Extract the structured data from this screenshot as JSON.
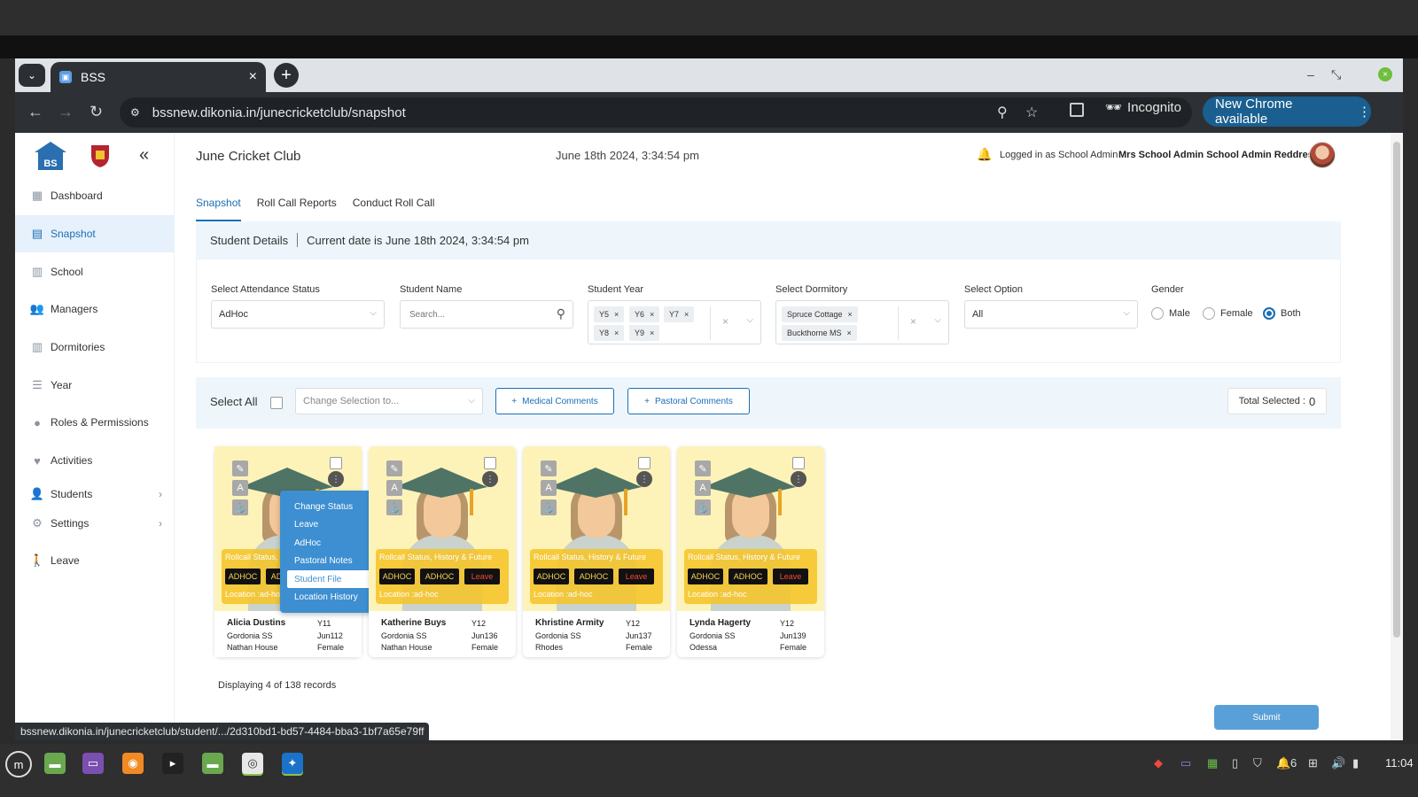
{
  "browser": {
    "tab_title": "BSS",
    "url": "bssnew.dikonia.in/junecricketclub/snapshot",
    "incognito_label": "Incognito",
    "update_label": "New Chrome available",
    "status_url": "bssnew.dikonia.in/junecricketclub/student/.../2d310bd1-bd57-4484-bba3-1bf7a65e79ff"
  },
  "sidebar": {
    "items": [
      {
        "label": "Dashboard",
        "icon": "dashboard-icon"
      },
      {
        "label": "Snapshot",
        "icon": "snapshot-icon",
        "active": true
      },
      {
        "label": "School",
        "icon": "school-icon"
      },
      {
        "label": "Managers",
        "icon": "managers-icon"
      },
      {
        "label": "Dormitories",
        "icon": "dormitories-icon"
      },
      {
        "label": "Year",
        "icon": "year-icon"
      },
      {
        "label": "Roles & Permissions",
        "icon": "roles-icon"
      },
      {
        "label": "Activities",
        "icon": "activities-icon"
      },
      {
        "label": "Students",
        "icon": "students-icon"
      },
      {
        "label": "Settings",
        "icon": "gear-icon"
      },
      {
        "label": "Leave",
        "icon": "leave-icon"
      }
    ]
  },
  "header": {
    "title": "June Cricket Club",
    "datetime": "June 18th 2024, 3:34:54 pm",
    "logged_in": "Logged in as School Admin",
    "user_name": "Mrs School Admin School Admin Reddress"
  },
  "tabs": [
    "Snapshot",
    "Roll Call Reports",
    "Conduct Roll Call"
  ],
  "student_details": {
    "title": "Student Details",
    "current_date": "Current date is June 18th 2024, 3:34:54 pm"
  },
  "filters": {
    "attendance_label": "Select Attendance Status",
    "attendance_value": "AdHoc",
    "name_label": "Student Name",
    "name_placeholder": "Search...",
    "year_label": "Student Year",
    "years": [
      "Y5",
      "Y6",
      "Y7",
      "Y8",
      "Y9"
    ],
    "dorm_label": "Select Dormitory",
    "dorms": [
      "Spruce Cottage",
      "Buckthorne MS"
    ],
    "option_label": "Select Option",
    "option_value": "All",
    "gender_label": "Gender",
    "genders": [
      "Male",
      "Female",
      "Both"
    ],
    "gender_selected": "Both"
  },
  "selection": {
    "select_all": "Select All",
    "change_placeholder": "Change Selection to...",
    "medical": "Medical Comments",
    "pastoral": "Pastoral Comments",
    "total_label": "Total Selected :",
    "total_value": "0"
  },
  "students": [
    {
      "name": "Alicia Dustins",
      "year": "Y11",
      "school": "Gordonia SS",
      "code": "Jun112",
      "house": "Nathan House",
      "gender": "Female"
    },
    {
      "name": "Katherine Buys",
      "year": "Y12",
      "school": "Gordonia SS",
      "code": "Jun136",
      "house": "Nathan House",
      "gender": "Female"
    },
    {
      "name": "Khristine Armity",
      "year": "Y12",
      "school": "Gordonia SS",
      "code": "Jun137",
      "house": "Rhodes",
      "gender": "Female"
    },
    {
      "name": "Lynda Hagerty",
      "year": "Y12",
      "school": "Gordonia SS",
      "code": "Jun139",
      "house": "Odessa",
      "gender": "Female"
    }
  ],
  "card_status": {
    "label": "Rollcall Status, History & Future",
    "badge1": "ADHOC",
    "badge2": "ADHOC",
    "badge3": "Leave",
    "location": "Location :ad-hoc"
  },
  "context_menu": [
    "Change Status",
    "Leave",
    "AdHoc",
    "Pastoral Notes",
    "Student File",
    "Location History"
  ],
  "records": "Displaying 4 of 138 records",
  "submit": "Submit",
  "taskbar": {
    "clock": "11:04",
    "tray_count": "6"
  },
  "colors": {
    "accent": "#1b6fb5",
    "menu": "#3d8fd1",
    "card_bg": "#fdf3b8",
    "badge_yellow": "#f7d354",
    "leave_red": "#f04a3a"
  }
}
